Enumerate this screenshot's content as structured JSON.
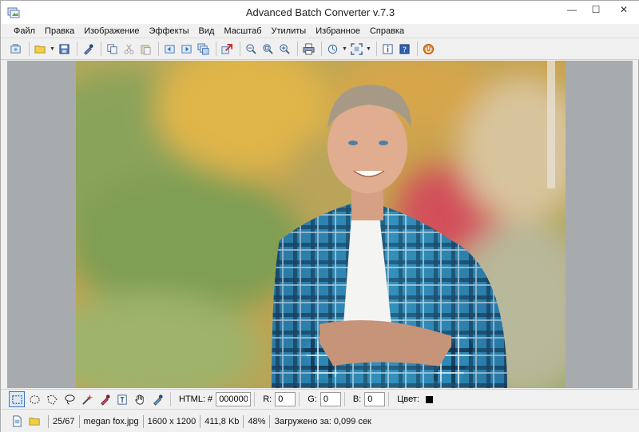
{
  "window": {
    "title": "Advanced Batch Converter v.7.3",
    "controls": {
      "minimize": "—",
      "maximize": "☐",
      "close": "✕"
    }
  },
  "menu": [
    "Файл",
    "Правка",
    "Изображение",
    "Эффекты",
    "Вид",
    "Масштаб",
    "Утилиты",
    "Избранное",
    "Справка"
  ],
  "toolbar": {
    "icons": [
      "browse-icon",
      "open-folder-icon",
      "save-icon",
      "eyedropper-icon",
      "copy-icon",
      "cut-icon",
      "paste-icon",
      "prev-image-icon",
      "next-image-icon",
      "batch-icon",
      "convert-icon",
      "zoom-out-icon",
      "zoom-fit-icon",
      "zoom-in-icon",
      "print-icon",
      "rotate-icon",
      "fullscreen-icon",
      "info-icon",
      "help-icon",
      "exit-icon"
    ]
  },
  "tools": {
    "icons": [
      "rect-select-icon",
      "ellipse-select-icon",
      "polygon-select-icon",
      "lasso-icon",
      "magic-wand-icon",
      "dropper-icon",
      "text-icon",
      "hand-icon",
      "pipette-icon"
    ],
    "html_label": "HTML: #",
    "html_value": "000000",
    "r_label": "R:",
    "r_value": "0",
    "g_label": "G:",
    "g_value": "0",
    "b_label": "B:",
    "b_value": "0",
    "color_label": "Цвет:",
    "color_value": "#000000"
  },
  "status": {
    "position": "25/67",
    "filename": "megan fox.jpg",
    "dimensions": "1600 x 1200",
    "filesize": "411,8 Kb",
    "zoom": "48%",
    "load_time": "Загружено за: 0,099 сек"
  }
}
